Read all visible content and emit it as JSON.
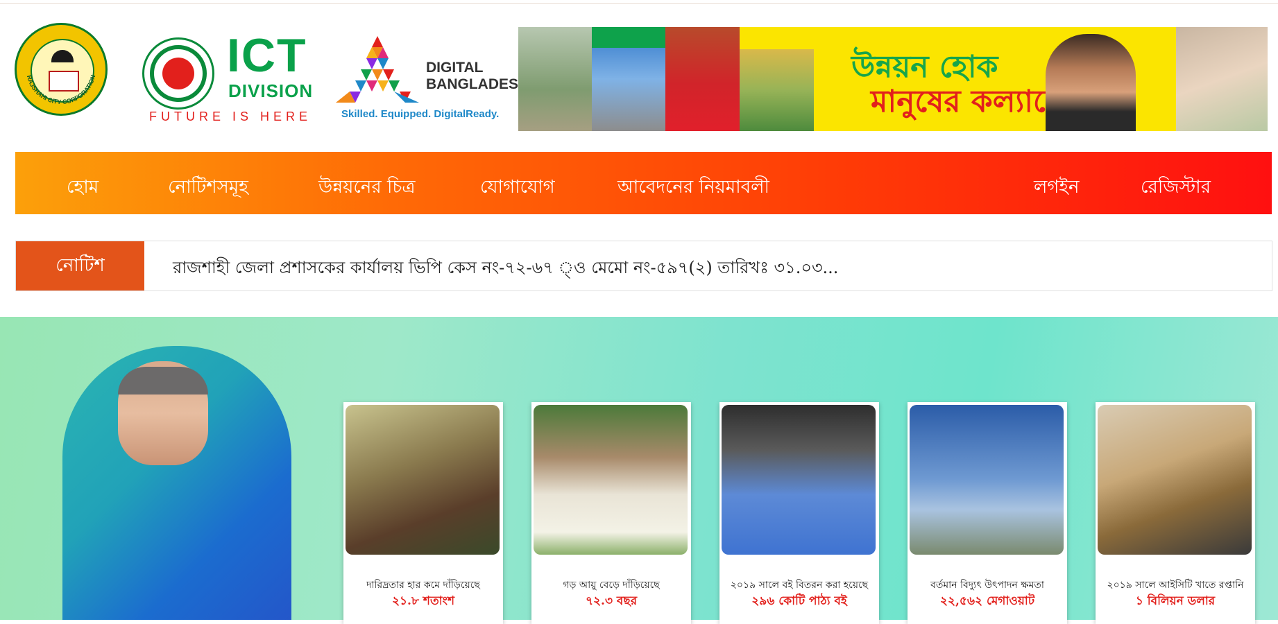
{
  "header": {
    "rcc_logo_text": "RAJSHAHI CITY CORPORATION",
    "ict_logo": {
      "big": "ICT",
      "division": "DIVISION",
      "tagline": "FUTURE IS HERE"
    },
    "digital_bangladesh": {
      "line1": "DIGITAL",
      "line2": "BANGLADESH",
      "tagline": "Skilled. Equipped. DigitalReady."
    },
    "banner": {
      "line1": "উন্নয়ন হোক",
      "line2": "মানুষের কল্যাণে"
    }
  },
  "nav": {
    "items": [
      {
        "label": "হোম"
      },
      {
        "label": "নোটিশসমূহ"
      },
      {
        "label": "উন্নয়নের চিত্র"
      },
      {
        "label": "যোগাযোগ"
      },
      {
        "label": "আবেদনের নিয়মাবলী"
      }
    ],
    "login": "লগইন",
    "register": "রেজিস্টার"
  },
  "notice": {
    "label": "নোটিশ",
    "text": "রাজশাহী জেলা প্রশাসকের কার্যালয় ভিপি কেস নং-৭২-৬৭ ্ও মেমো নং-৫৯৭(২) তারিখঃ ৩১.০৩..."
  },
  "cards": [
    {
      "caption": "দারিদ্রতার হার কমে দাঁড়িয়েছে",
      "value": "২১.৮ শতাংশ",
      "icon": "poverty-photo"
    },
    {
      "caption": "গড় আয়ু বেড়ে দাঁড়িয়েছে",
      "value": "৭২.৩ বছর",
      "icon": "elderly-man-photo"
    },
    {
      "caption": "২০১৯ সালে বই বিতরন করা হয়েছে",
      "value": "২৯৬ কোটি পাঠ্য বই",
      "icon": "schoolgirls-photo"
    },
    {
      "caption": "বর্তমান বিদ্যুৎ উৎপাদন ক্ষমতা",
      "value": "২২,৫৬২ মেগাওয়াট",
      "icon": "power-tower-photo"
    },
    {
      "caption": "২০১৯ সালে আইসিটি খাতে রপ্তানি",
      "value": "১ বিলিয়ন ডলার",
      "icon": "computer-desk-photo"
    }
  ],
  "colors": {
    "nav_gradient_start": "#fca00a",
    "nav_gradient_end": "#ff1010",
    "notice_label_bg": "#e3541a",
    "card_value": "#e2201c"
  }
}
